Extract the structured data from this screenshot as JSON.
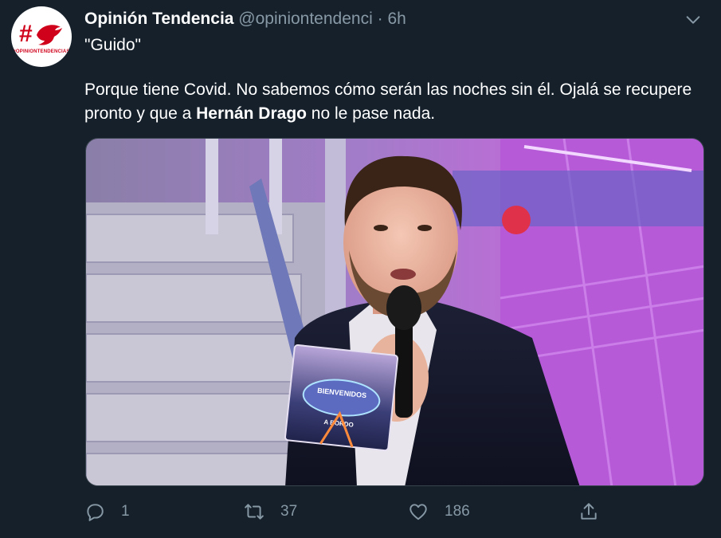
{
  "tweet": {
    "display_name": "Opinión Tendencia",
    "handle": "@opiniontendenci",
    "separator": "·",
    "time": "6h",
    "line1": "\"Guido\"",
    "para_part1": "Porque tiene Covid. No sabemos cómo serán las noches sin él. Ojalá se recupere pronto y que a ",
    "para_bold": "Hernán Drago",
    "para_part2": " no le pase nada.",
    "avatar_caption": "#OPINIONTENDENCIAS",
    "media_overlay_text_1": "BIENVENIDOS",
    "media_overlay_text_2": "A BORDO"
  },
  "actions": {
    "reply_count": "1",
    "retweet_count": "37",
    "like_count": "186"
  },
  "icons": {
    "reply": "reply-icon",
    "retweet": "retweet-icon",
    "like": "heart-icon",
    "share": "share-icon",
    "more": "chevron-down-icon"
  },
  "colors": {
    "background": "#15202b",
    "secondary_text": "#8899a6",
    "brand_red": "#d0021b"
  }
}
